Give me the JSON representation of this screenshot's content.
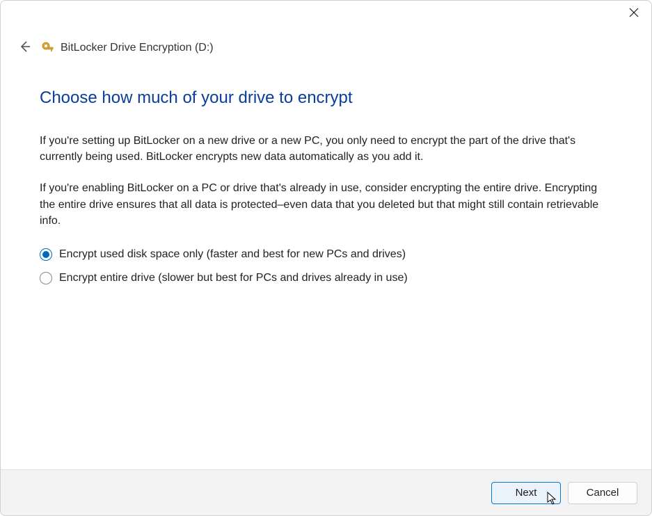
{
  "header": {
    "title": "BitLocker Drive Encryption (D:)"
  },
  "page": {
    "heading": "Choose how much of your drive to encrypt",
    "para1": "If you're setting up BitLocker on a new drive or a new PC, you only need to encrypt the part of the drive that's currently being used. BitLocker encrypts new data automatically as you add it.",
    "para2": "If you're enabling BitLocker on a PC or drive that's already in use, consider encrypting the entire drive. Encrypting the entire drive ensures that all data is protected–even data that you deleted but that might still contain retrievable info."
  },
  "options": {
    "opt1": {
      "label": "Encrypt used disk space only (faster and best for new PCs and drives)",
      "selected": true
    },
    "opt2": {
      "label": "Encrypt entire drive (slower but best for PCs and drives already in use)",
      "selected": false
    }
  },
  "footer": {
    "next": "Next",
    "cancel": "Cancel"
  }
}
